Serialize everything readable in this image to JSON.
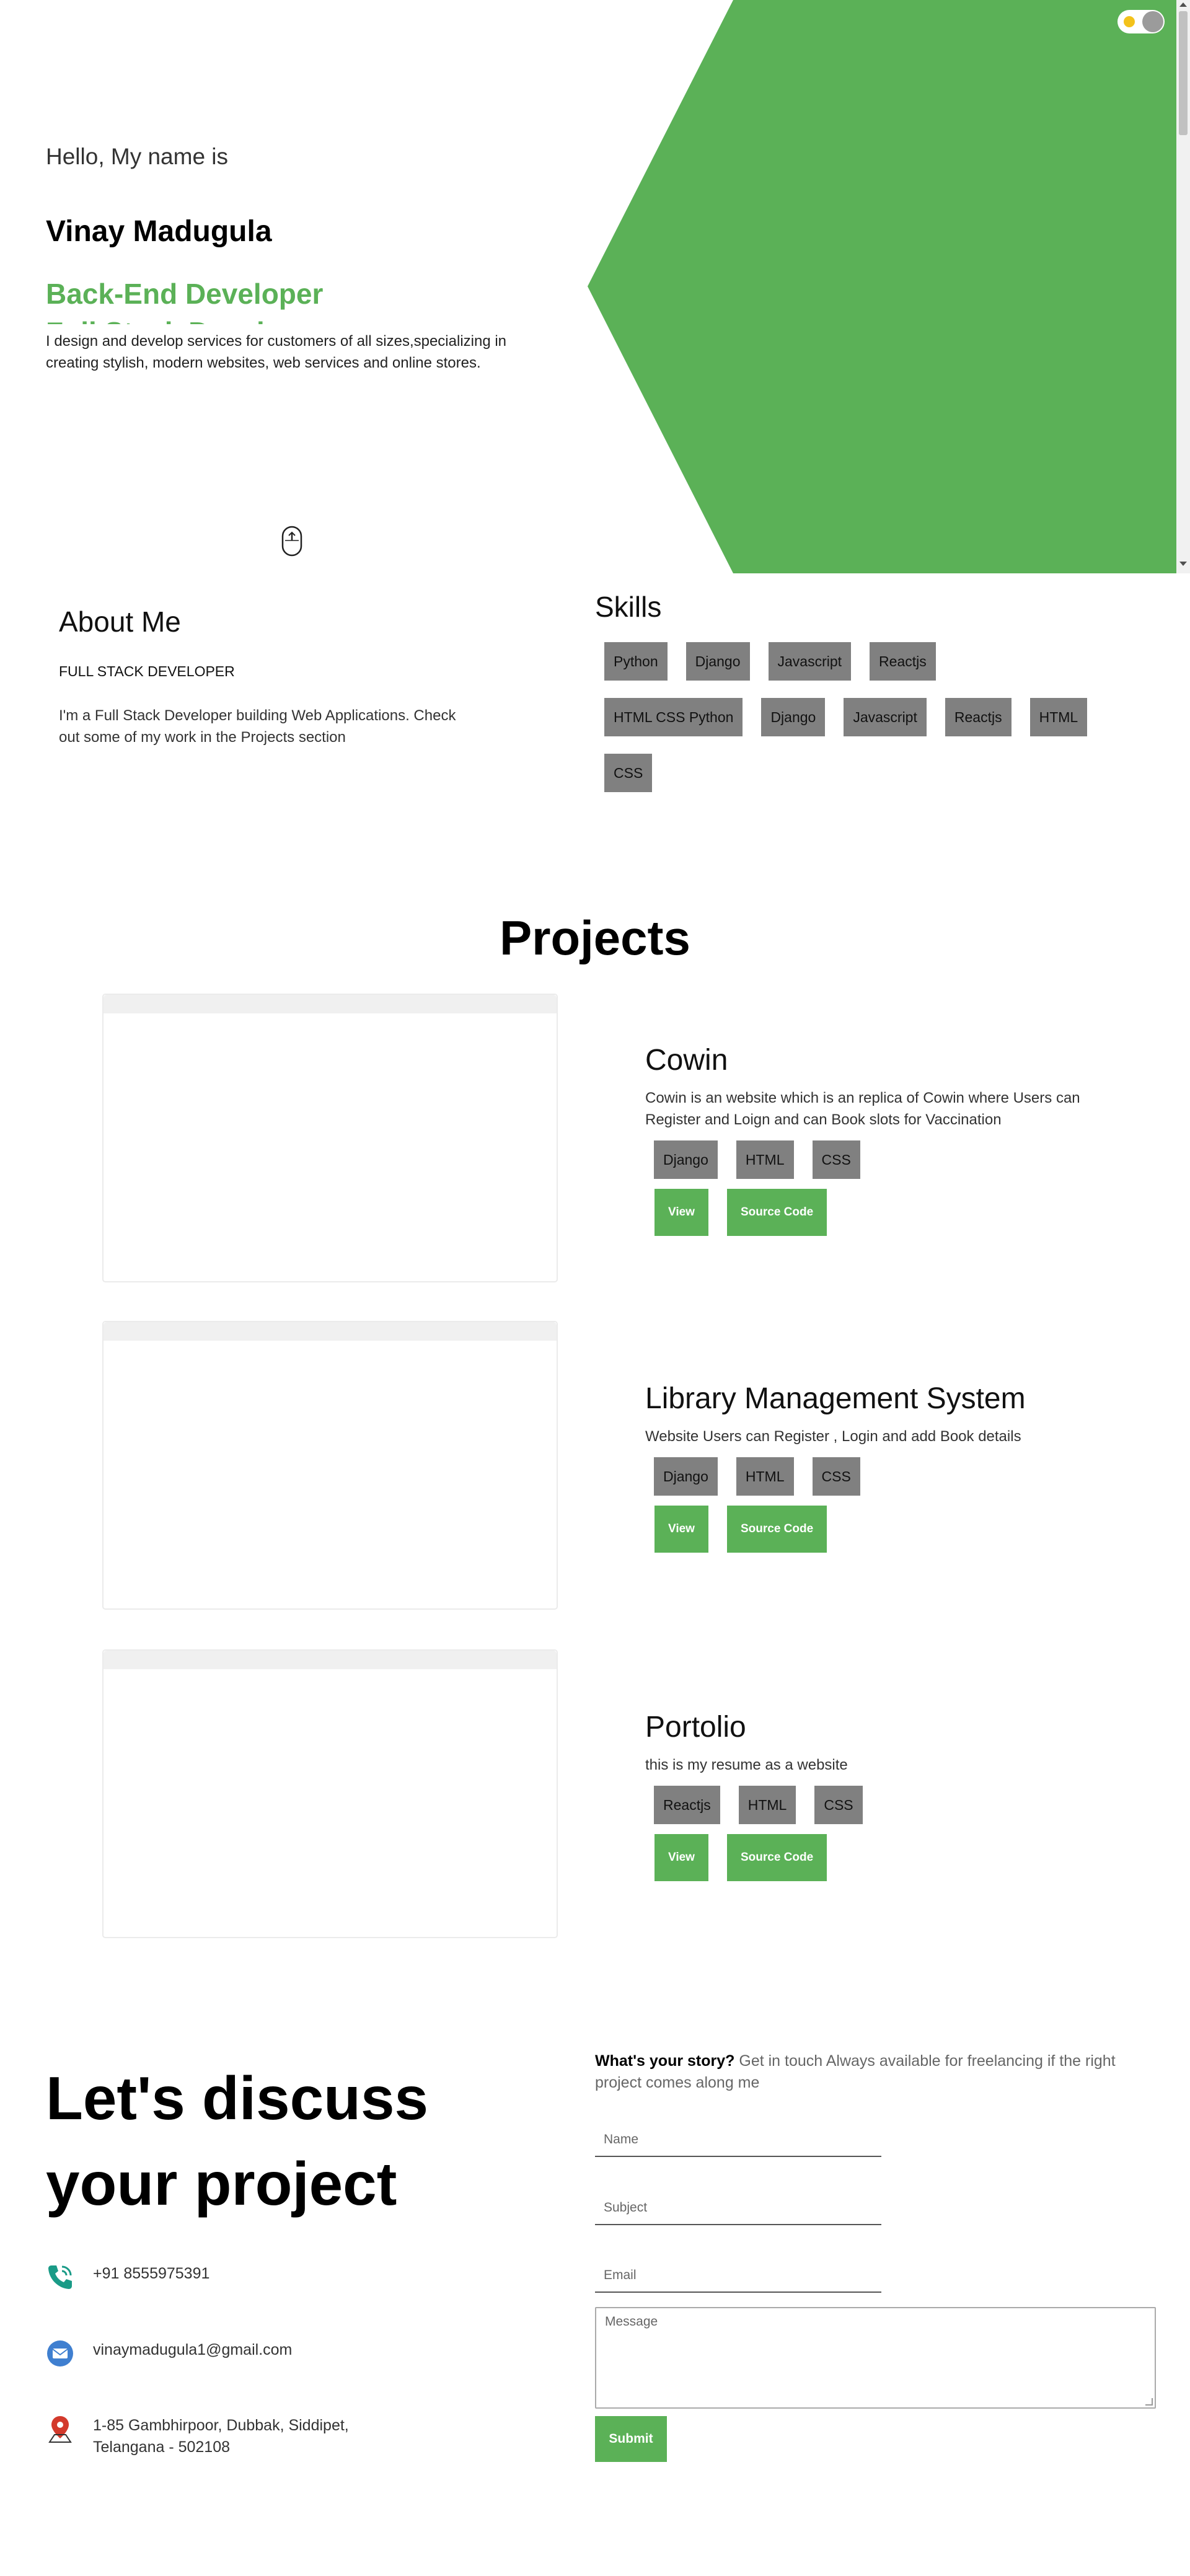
{
  "hero": {
    "greeting": "Hello, My name is",
    "name": "Vinay Madugula",
    "roles": [
      "Back-End Developer",
      "Full Stack Develo"
    ],
    "description": "I design and develop services for customers of all sizes,specializing in creating stylish, modern websites, web services and online stores.",
    "accent_color": "#5bb157",
    "toggle_icon": "sun-icon",
    "scroll_icon": "mouse-scroll-icon"
  },
  "about": {
    "title": "About Me",
    "subtitle": "FULL STACK DEVELOPER",
    "text": "I'm a Full Stack Developer building Web Applications. Check out some of my work in the Projects section"
  },
  "skills": {
    "title": "Skills",
    "items": [
      "Python",
      "Django",
      "Javascript",
      "Reactjs",
      "HTML CSS Python",
      "Django",
      "Javascript",
      "Reactjs",
      "HTML",
      "CSS"
    ]
  },
  "projects": {
    "title": "Projects",
    "items": [
      {
        "name": "Cowin",
        "description": "Cowin is an website which is an replica of Cowin where Users can Register and Loign and can Book slots for Vaccination",
        "tags": [
          "Django",
          "HTML",
          "CSS"
        ],
        "view_label": "View",
        "source_label": "Source Code"
      },
      {
        "name": "Library Management System",
        "description": "Website Users can Register , Login and add Book details",
        "tags": [
          "Django",
          "HTML",
          "CSS"
        ],
        "view_label": "View",
        "source_label": "Source Code"
      },
      {
        "name": "Portolio",
        "description": "this is my resume as a website",
        "tags": [
          "Reactjs",
          "HTML",
          "CSS"
        ],
        "view_label": "View",
        "source_label": "Source Code"
      }
    ]
  },
  "contact": {
    "heading_line1": "Let's discuss",
    "heading_line2": "your project",
    "phone": "+91 8555975391",
    "email": "vinaymadugula1@gmail.com",
    "address_line1": "1-85 Gambhirpoor, Dubbak, Siddipet,",
    "address_line2": "Telangana - 502108",
    "story_bold": "What's your story?",
    "story_text": " Get in touch Always available for freelancing if the right project comes along me",
    "name_placeholder": "Name",
    "subject_placeholder": "Subject",
    "email_placeholder": "Email",
    "message_placeholder": "Message",
    "submit_label": "Submit"
  }
}
